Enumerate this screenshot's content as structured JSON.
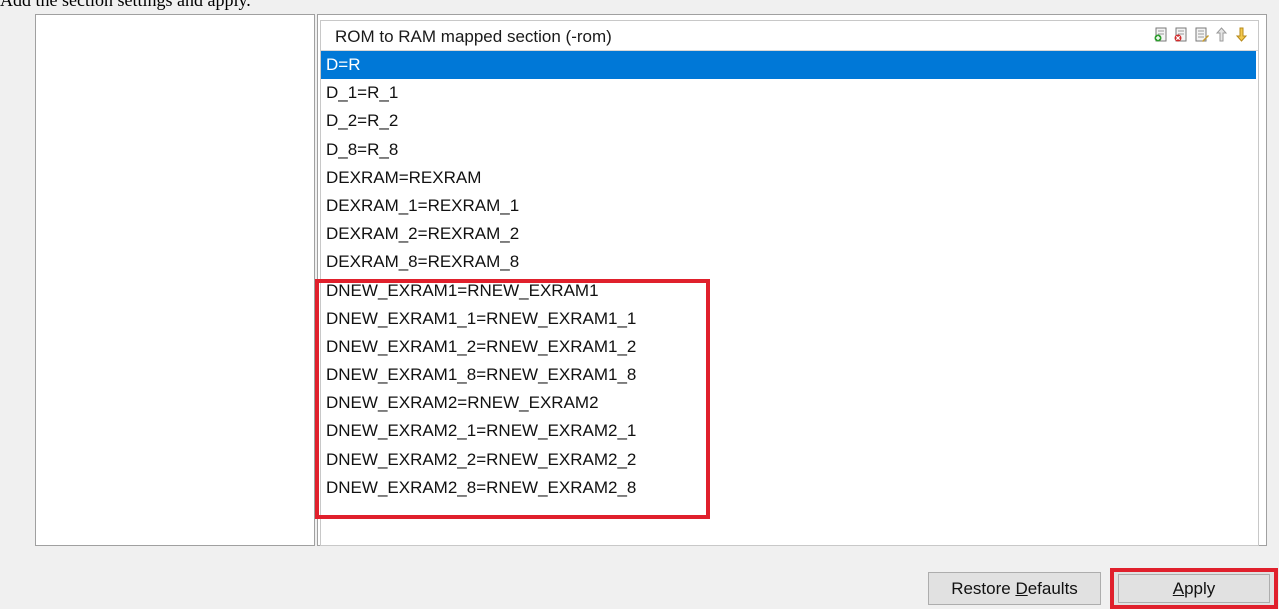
{
  "caption": "Add the section settings and apply.",
  "list": {
    "title": "ROM to RAM mapped section (-rom)",
    "toolbar_icons": [
      "add-icon",
      "delete-icon",
      "edit-icon",
      "move-up-icon",
      "move-down-icon"
    ],
    "rows": [
      "D=R",
      "D_1=R_1",
      "D_2=R_2",
      "D_8=R_8",
      "DEXRAM=REXRAM",
      "DEXRAM_1=REXRAM_1",
      "DEXRAM_2=REXRAM_2",
      "DEXRAM_8=REXRAM_8",
      "DNEW_EXRAM1=RNEW_EXRAM1",
      "DNEW_EXRAM1_1=RNEW_EXRAM1_1",
      "DNEW_EXRAM1_2=RNEW_EXRAM1_2",
      "DNEW_EXRAM1_8=RNEW_EXRAM1_8",
      "DNEW_EXRAM2=RNEW_EXRAM2",
      "DNEW_EXRAM2_1=RNEW_EXRAM2_1",
      "DNEW_EXRAM2_2=RNEW_EXRAM2_2",
      "DNEW_EXRAM2_8=RNEW_EXRAM2_8"
    ],
    "selected_index": 0
  },
  "buttons": {
    "restore_defaults_prefix": "Restore ",
    "restore_defaults_mnemonic": "D",
    "restore_defaults_suffix": "efaults",
    "apply_mnemonic": "A",
    "apply_suffix": "pply"
  },
  "colors": {
    "selection": "#0078d7",
    "highlight": "#e0202c"
  }
}
